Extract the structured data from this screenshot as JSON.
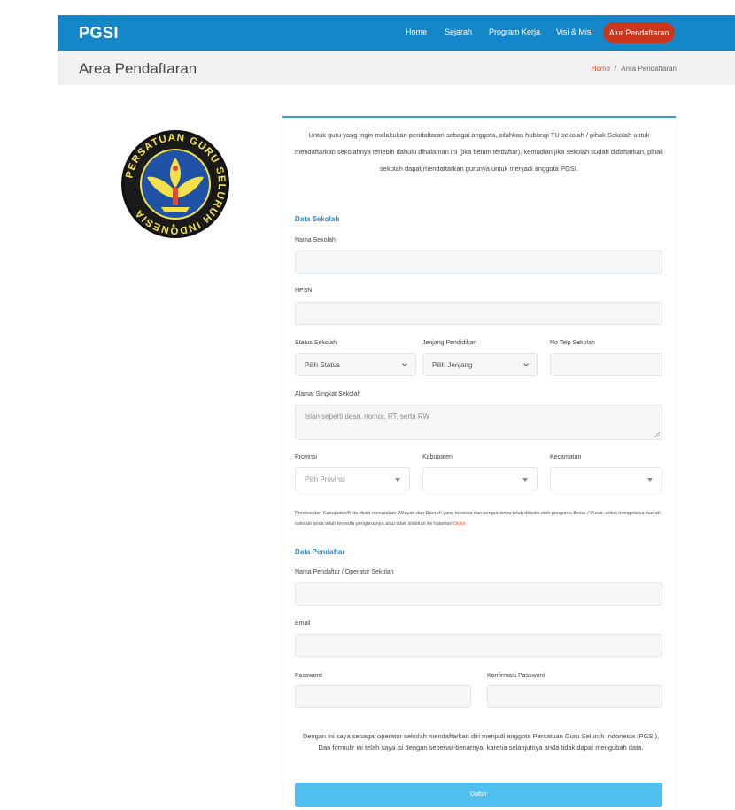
{
  "brand": "PGSI",
  "nav": {
    "items": [
      "Home",
      "Sejarah",
      "Program Kerja",
      "Visi & Misi"
    ],
    "cta": "Alur Pendaftaran"
  },
  "page": {
    "title": "Area Pendaftaran",
    "breadcrumb": {
      "home": "Home",
      "separator": "/",
      "current": "Area Pendaftaran"
    }
  },
  "logo": {
    "text": "PERSATUAN GURU SELURUH INDONESIA"
  },
  "form": {
    "intro": "Untuk guru yang ingin melakukan pendaftaran sebagai anggota, silahkan hubungi TU sekolah / pihak Sekolah untuk mendaftarkan sekolahnya terlebih dahulu dihalaman ini (jika belum terdaftar), kemudian jika sekolah sudah didaftarkan, pihak sekolah dapat mendaftarkan gurunya untuk menjadi anggota PGSI.",
    "school_section": "Data Sekolah",
    "fields": {
      "school_name": {
        "label": "Nama Sekolah",
        "value": ""
      },
      "npsn": {
        "label": "NPSN",
        "value": ""
      },
      "status": {
        "label": "Status Sekolah",
        "selected": "Pilih Status"
      },
      "level": {
        "label": "Jenjang Pendidikan",
        "selected": "Pilih Jenjang"
      },
      "phone": {
        "label": "No Telp Sekolah",
        "value": ""
      },
      "address": {
        "label": "Alamat Singkat Sekolah",
        "placeholder": "Isian seperti desa, nomor, RT, serta RW"
      },
      "province": {
        "label": "Provinsi",
        "selected": "Pilih Provinsi"
      },
      "regency": {
        "label": "Kabupaten",
        "selected": ""
      },
      "district": {
        "label": "Kecamatan",
        "selected": ""
      }
    },
    "note_text": "Provinsi dan Kabupaten/Kota disini merupakan Wilayah dan Daerah yang tersedia dan pengurusnya telah dilantik oleh pengurus Besar / Pusat, untuk mengetahui daerah sekolah anda telah tersedia pengurusnya atau tidak silahkan ke halaman",
    "note_link": "Disini",
    "registrant_section": "Data Pendaftar",
    "registrant": {
      "name": {
        "label": "Nama Pendaftar / Operator Sekolah",
        "value": ""
      },
      "email": {
        "label": "Email",
        "value": ""
      },
      "password": {
        "label": "Password",
        "value": ""
      },
      "confirm": {
        "label": "Konfirmasi Password",
        "value": ""
      }
    },
    "consent": "Dengan ini saya sebagai operator sekolah mendaftarkan diri menjadi anggota Persatuan Guru Seluruh Indonesia (PGSI), Dan formulir ini telah saya isi dengan sebenar-benarnya, karena selanjutnya anda tidak dapat mengubah data.",
    "submit": "Daftar"
  },
  "colors": {
    "topbar": "#1487c8",
    "cta": "#c9371e",
    "accent": "#2a86c8",
    "link": "#e0502e",
    "submit": "#4fc0f0"
  }
}
